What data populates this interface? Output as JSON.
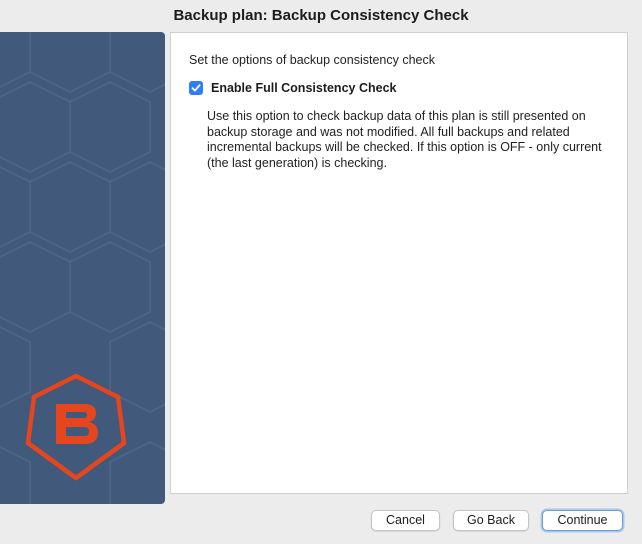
{
  "window": {
    "title": "Backup plan: Backup Consistency Check"
  },
  "sidebar": {
    "logo_icon": "brand-b-hexagon-icon",
    "background_color": "#415a7b",
    "accent_color": "#e6461e"
  },
  "content": {
    "intro_text": "Set the options of backup consistency check",
    "checkbox": {
      "label": "Enable Full Consistency Check",
      "checked": true
    },
    "description": "Use this option to check backup data of this plan is still presented on backup storage and was not modified. All full backups and related incremental backups will be checked. If this option is OFF - only current (the last generation) is checking."
  },
  "footer": {
    "cancel_label": "Cancel",
    "back_label": "Go Back",
    "continue_label": "Continue"
  }
}
